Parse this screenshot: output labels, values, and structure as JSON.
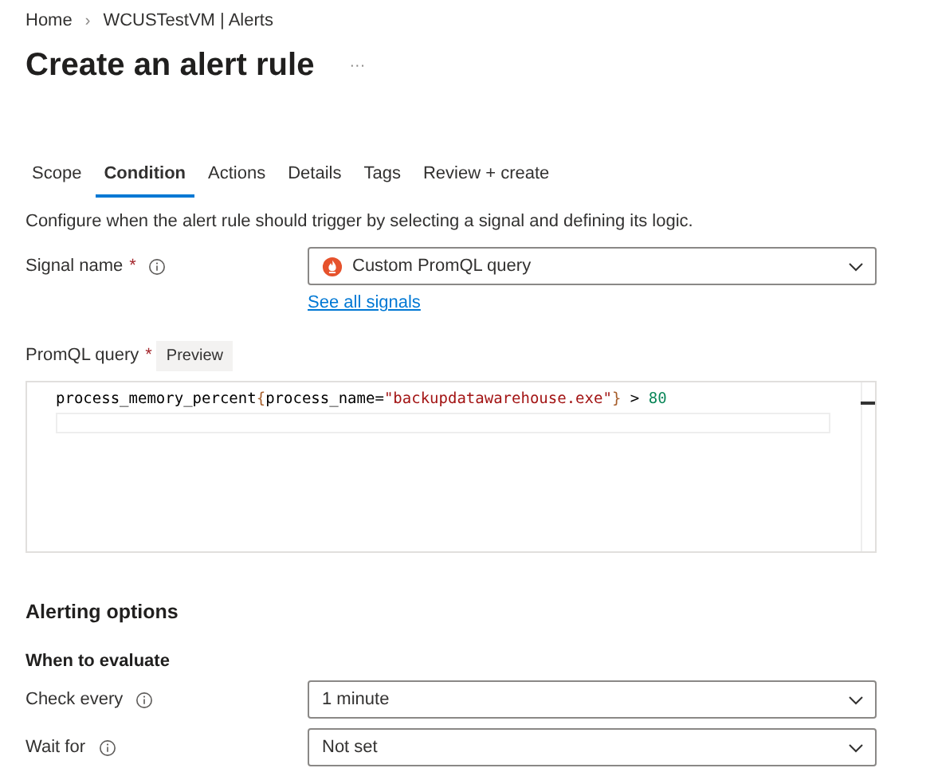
{
  "breadcrumb": [
    {
      "label": "Home"
    },
    {
      "label": "WCUSTestVM | Alerts"
    }
  ],
  "breadcrumb_separator": "›",
  "title": "Create an alert rule",
  "more": "···",
  "tabs": [
    {
      "label": "Scope",
      "selected": false
    },
    {
      "label": "Condition",
      "selected": true
    },
    {
      "label": "Actions",
      "selected": false
    },
    {
      "label": "Details",
      "selected": false
    },
    {
      "label": "Tags",
      "selected": false
    },
    {
      "label": "Review + create",
      "selected": false
    }
  ],
  "description": "Configure when the alert rule should trigger by selecting a signal and defining its logic.",
  "signal": {
    "label": "Signal name",
    "required_mark": "*",
    "value": "Custom PromQL query",
    "link": "See all signals"
  },
  "query": {
    "label": "PromQL query",
    "required_mark": "*",
    "preview_button": "Preview",
    "tokens": [
      {
        "kind": "plain",
        "text": "process_memory_percent"
      },
      {
        "kind": "brace",
        "text": "{"
      },
      {
        "kind": "plain",
        "text": "process_name="
      },
      {
        "kind": "string",
        "text": "\"backupdatawarehouse.exe\""
      },
      {
        "kind": "brace",
        "text": "}"
      },
      {
        "kind": "plain",
        "text": " > "
      },
      {
        "kind": "number",
        "text": "80"
      }
    ]
  },
  "alerting_options": {
    "heading": "Alerting options",
    "subheading": "When to evaluate",
    "fields": [
      {
        "label": "Check every",
        "value": "1 minute"
      },
      {
        "label": "Wait for",
        "value": "Not set"
      }
    ]
  }
}
